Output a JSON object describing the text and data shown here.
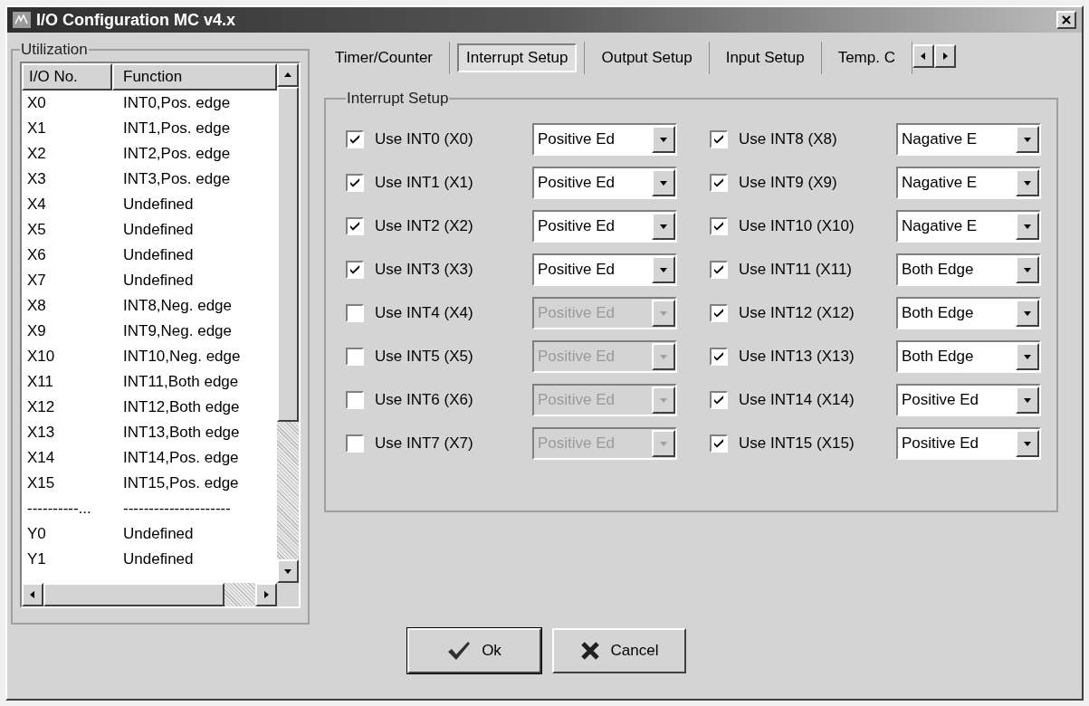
{
  "window": {
    "title": "I/O Configuration MC v4.x"
  },
  "utilization": {
    "title": "Utilization",
    "columns": [
      "I/O No.",
      "Function"
    ],
    "rows": [
      {
        "io": "X0",
        "function": "INT0,Pos. edge"
      },
      {
        "io": "X1",
        "function": "INT1,Pos. edge"
      },
      {
        "io": "X2",
        "function": "INT2,Pos. edge"
      },
      {
        "io": "X3",
        "function": "INT3,Pos. edge"
      },
      {
        "io": "X4",
        "function": "Undefined"
      },
      {
        "io": "X5",
        "function": "Undefined"
      },
      {
        "io": "X6",
        "function": "Undefined"
      },
      {
        "io": "X7",
        "function": "Undefined"
      },
      {
        "io": "X8",
        "function": "INT8,Neg. edge"
      },
      {
        "io": "X9",
        "function": "INT9,Neg. edge"
      },
      {
        "io": "X10",
        "function": "INT10,Neg. edge"
      },
      {
        "io": "X11",
        "function": "INT11,Both edge"
      },
      {
        "io": "X12",
        "function": "INT12,Both edge"
      },
      {
        "io": "X13",
        "function": "INT13,Both edge"
      },
      {
        "io": "X14",
        "function": "INT14,Pos. edge"
      },
      {
        "io": "X15",
        "function": "INT15,Pos. edge"
      },
      {
        "io": "----------...",
        "function": "---------------------"
      },
      {
        "io": "Y0",
        "function": "Undefined"
      },
      {
        "io": "Y1",
        "function": "Undefined"
      }
    ]
  },
  "tabs": [
    {
      "label": "Timer/Counter",
      "selected": false
    },
    {
      "label": "Interrupt Setup",
      "selected": true
    },
    {
      "label": "Output Setup",
      "selected": false
    },
    {
      "label": "Input Setup",
      "selected": false
    },
    {
      "label": "Temp. C",
      "selected": false
    }
  ],
  "interrupt_setup": {
    "title": "Interrupt Setup",
    "left": [
      {
        "label": "Use INT0 (X0)",
        "checked": true,
        "value": "Positive Ed",
        "disabled": false
      },
      {
        "label": "Use INT1 (X1)",
        "checked": true,
        "value": "Positive Ed",
        "disabled": false
      },
      {
        "label": "Use INT2 (X2)",
        "checked": true,
        "value": "Positive Ed",
        "disabled": false
      },
      {
        "label": "Use INT3 (X3)",
        "checked": true,
        "value": "Positive Ed",
        "disabled": false
      },
      {
        "label": "Use INT4 (X4)",
        "checked": false,
        "value": "Positive Ed",
        "disabled": true
      },
      {
        "label": "Use INT5 (X5)",
        "checked": false,
        "value": "Positive Ed",
        "disabled": true
      },
      {
        "label": "Use INT6 (X6)",
        "checked": false,
        "value": "Positive Ed",
        "disabled": true
      },
      {
        "label": "Use INT7 (X7)",
        "checked": false,
        "value": "Positive Ed",
        "disabled": true
      }
    ],
    "right": [
      {
        "label": "Use INT8 (X8)",
        "checked": true,
        "value": "Nagative E",
        "disabled": false
      },
      {
        "label": "Use INT9 (X9)",
        "checked": true,
        "value": "Nagative E",
        "disabled": false
      },
      {
        "label": "Use INT10 (X10)",
        "checked": true,
        "value": "Nagative E",
        "disabled": false
      },
      {
        "label": "Use INT11 (X11)",
        "checked": true,
        "value": "Both Edge",
        "disabled": false
      },
      {
        "label": "Use INT12 (X12)",
        "checked": true,
        "value": "Both Edge",
        "disabled": false
      },
      {
        "label": "Use INT13 (X13)",
        "checked": true,
        "value": "Both Edge",
        "disabled": false
      },
      {
        "label": "Use INT14 (X14)",
        "checked": true,
        "value": "Positive Ed",
        "disabled": false
      },
      {
        "label": "Use INT15 (X15)",
        "checked": true,
        "value": "Positive Ed",
        "disabled": false
      }
    ]
  },
  "buttons": [
    {
      "kind": "ok",
      "label": "Ok"
    },
    {
      "kind": "cancel",
      "label": "Cancel"
    }
  ]
}
